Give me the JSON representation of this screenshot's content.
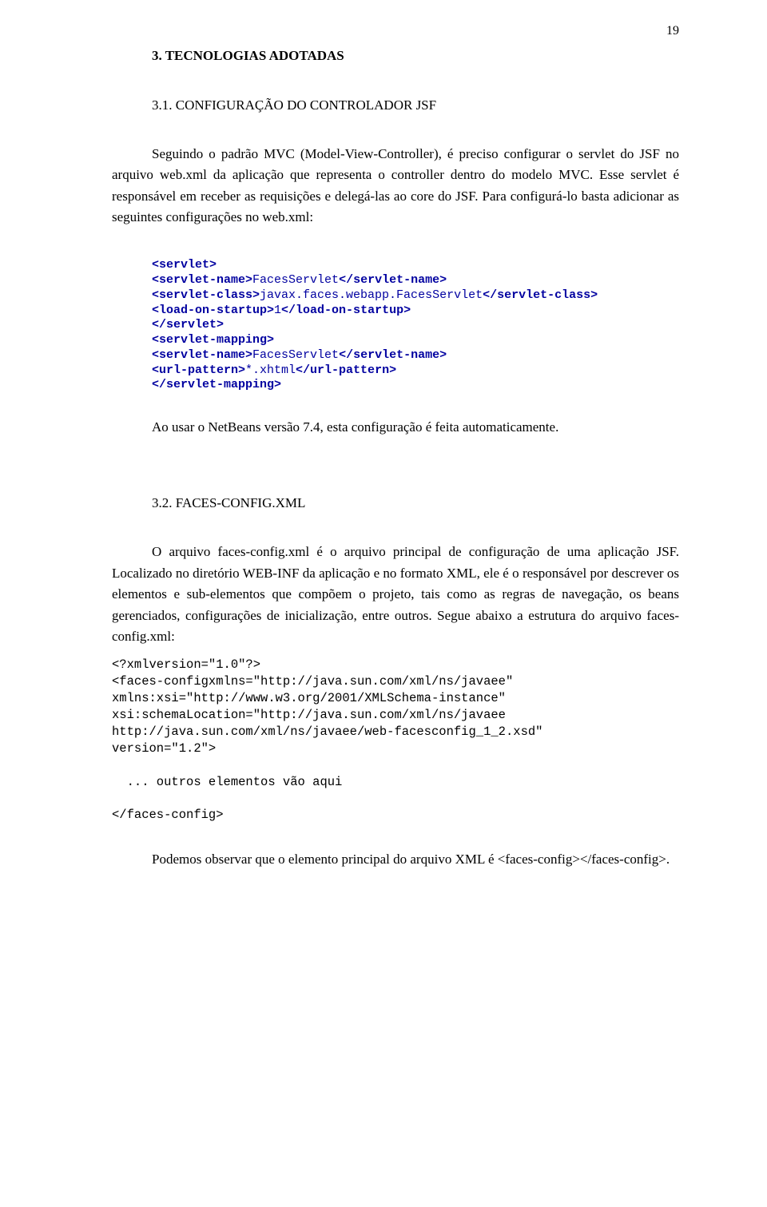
{
  "pageNumber": "19",
  "sectionTitle": "3.   TECNOLOGIAS ADOTADAS",
  "sub1": {
    "title": "3.1. CONFIGURAÇÃO DO CONTROLADOR JSF",
    "p1": "Seguindo o padrão MVC (Model-View-Controller), é preciso configurar o servlet do JSF no arquivo web.xml da aplicação que representa o controller dentro do modelo MVC. Esse servlet é responsável em receber as requisições e delegá-las ao core do JSF. Para configurá-lo basta adicionar as seguintes configurações no web.xml:",
    "code": "<servlet>\n<servlet-name>FacesServlet</servlet-name>\n<servlet-class>javax.faces.webapp.FacesServlet</servlet-class>\n<load-on-startup>1</load-on-startup>\n</servlet>\n<servlet-mapping>\n<servlet-name>FacesServlet</servlet-name>\n<url-pattern>*.xhtml</url-pattern>\n</servlet-mapping>",
    "p2": "Ao usar o NetBeans versão 7.4, esta configuração é feita automaticamente."
  },
  "sub2": {
    "title": "3.2. FACES-CONFIG.XML",
    "p1": "O arquivo faces-config.xml é o arquivo principal de configuração de uma aplicação JSF. Localizado no diretório WEB-INF da aplicação e no formato XML, ele é o responsável por descrever os elementos e sub-elementos que compõem o projeto, tais como as regras de navegação, os beans gerenciados, configurações de inicialização, entre outros. Segue abaixo a estrutura do arquivo faces-config.xml:",
    "code": "<?xmlversion=\"1.0\"?>\n<faces-configxmlns=\"http://java.sun.com/xml/ns/javaee\"\nxmlns:xsi=\"http://www.w3.org/2001/XMLSchema-instance\"\nxsi:schemaLocation=\"http://java.sun.com/xml/ns/javaee\nhttp://java.sun.com/xml/ns/javaee/web-facesconfig_1_2.xsd\"\nversion=\"1.2\">\n\n  ... outros elementos vão aqui\n\n</faces-config>",
    "p2": "Podemos observar que o elemento principal do arquivo XML é <faces-config></faces-config>."
  }
}
